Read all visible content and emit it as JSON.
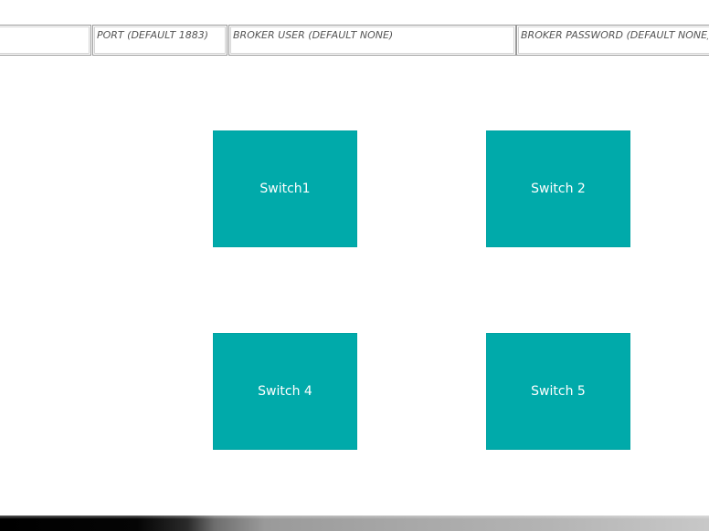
{
  "form": {
    "host": {
      "value": "",
      "placeholder": ""
    },
    "port": {
      "value": "",
      "placeholder": "PORT (DEFAULT 1883)"
    },
    "user": {
      "value": "",
      "placeholder": "BROKER USER (DEFAULT NONE)"
    },
    "password": {
      "value": "",
      "placeholder": "BROKER PASSWORD (DEFAULT NONE)"
    }
  },
  "switches": [
    {
      "label": "Switch1"
    },
    {
      "label": "Switch 2"
    },
    {
      "label": "Switch 4"
    },
    {
      "label": "Switch 5"
    }
  ],
  "colors": {
    "tile": "#00aaaa",
    "tile_text": "#ffffff",
    "placeholder_text": "#555555"
  }
}
